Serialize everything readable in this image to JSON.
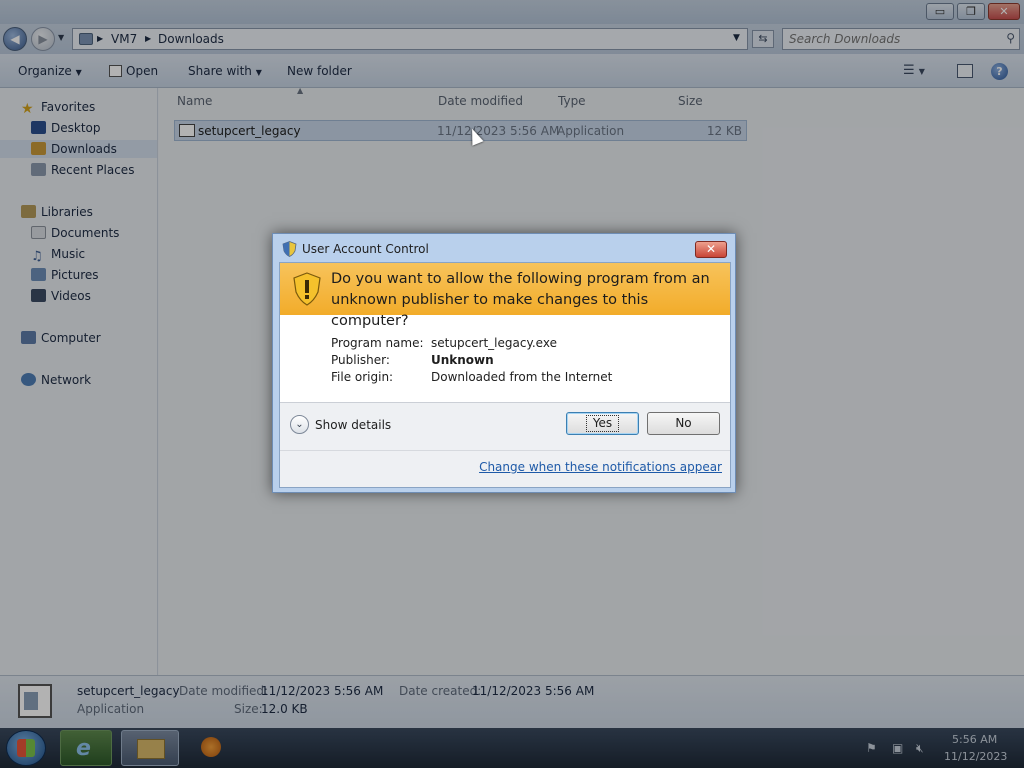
{
  "window": {
    "controls": {
      "minimize": "▭",
      "restore": "❐",
      "close": "✕"
    }
  },
  "address": {
    "back_icon": "back-arrow-icon",
    "forward_icon": "forward-arrow-icon",
    "path": [
      "VM7",
      "Downloads"
    ],
    "search_placeholder": "Search Downloads"
  },
  "toolbar": {
    "organize": "Organize",
    "open": "Open",
    "share_with": "Share with",
    "new_folder": "New folder"
  },
  "sidebar": {
    "favorites": "Favorites",
    "desktop": "Desktop",
    "downloads": "Downloads",
    "recent_places": "Recent Places",
    "libraries": "Libraries",
    "documents": "Documents",
    "music": "Music",
    "pictures": "Pictures",
    "videos": "Videos",
    "computer": "Computer",
    "network": "Network"
  },
  "columns": {
    "name": "Name",
    "date_modified": "Date modified",
    "type": "Type",
    "size": "Size"
  },
  "files": [
    {
      "name": "setupcert_legacy",
      "date_modified": "11/12/2023 5:56 AM",
      "type": "Application",
      "size": "12 KB"
    }
  ],
  "details": {
    "name": "setupcert_legacy",
    "type": "Application",
    "date_modified_label": "Date modified:",
    "date_modified": "11/12/2023 5:56 AM",
    "date_created_label": "Date created:",
    "date_created": "11/12/2023 5:56 AM",
    "size_label": "Size:",
    "size": "12.0 KB"
  },
  "uac": {
    "title": "User Account Control",
    "question": "Do you want to allow the following program from an unknown publisher to make changes to this computer?",
    "program_name_label": "Program name:",
    "program_name": "setupcert_legacy.exe",
    "publisher_label": "Publisher:",
    "publisher": "Unknown",
    "file_origin_label": "File origin:",
    "file_origin": "Downloaded from the Internet",
    "show_details": "Show details",
    "yes": "Yes",
    "no": "No",
    "change_link": "Change when these notifications appear"
  },
  "taskbar": {
    "time": "5:56 AM",
    "date": "11/12/2023"
  },
  "colors": {
    "banner": "#f2ac2a",
    "link": "#1e5aa8",
    "selection": "#c7d6e8"
  }
}
